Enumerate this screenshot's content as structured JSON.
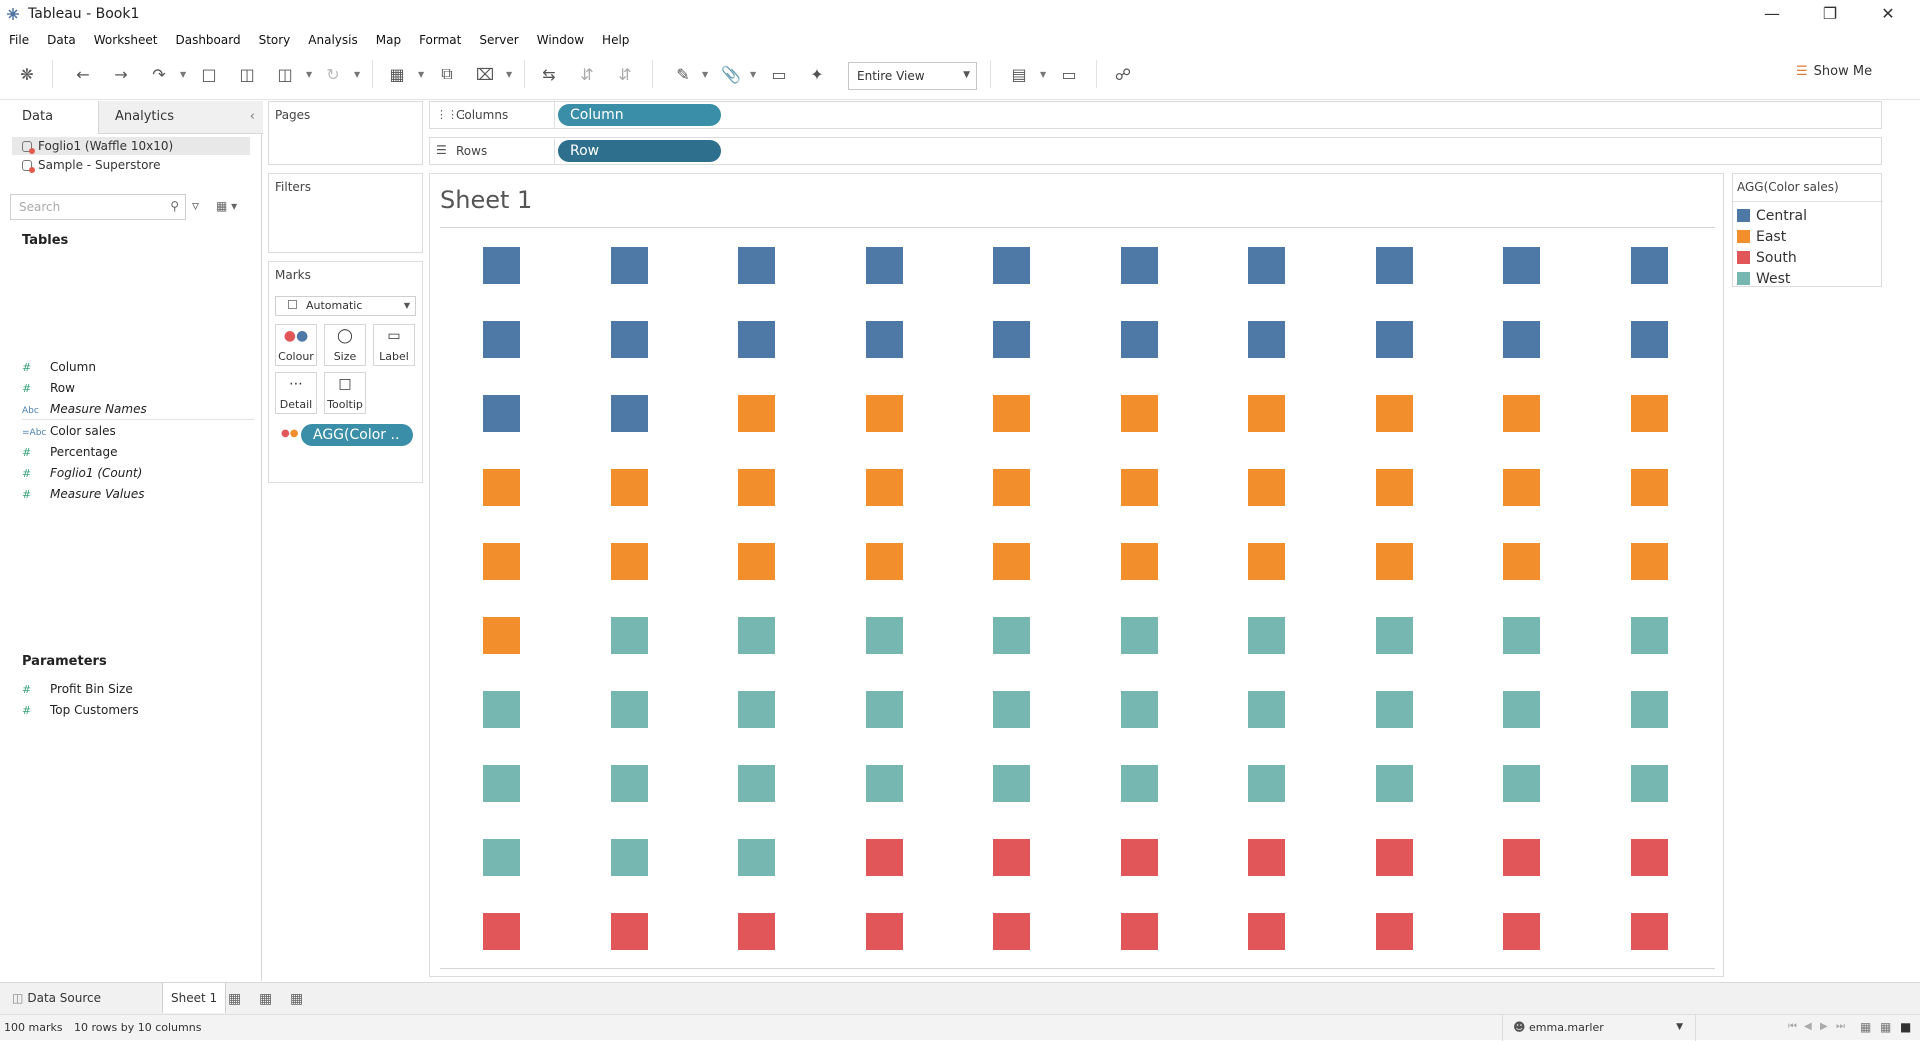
{
  "window": {
    "title": "Tableau - Book1"
  },
  "menu": [
    "File",
    "Data",
    "Worksheet",
    "Dashboard",
    "Story",
    "Analysis",
    "Map",
    "Format",
    "Server",
    "Window",
    "Help"
  ],
  "toolbar": {
    "view_mode": "Entire View",
    "show_me": "Show Me"
  },
  "left_pane": {
    "tabs": [
      "Data",
      "Analytics"
    ],
    "sources": [
      {
        "label": "Foglio1 (Waffle 10x10)",
        "selected": true
      },
      {
        "label": "Sample - Superstore",
        "selected": false
      }
    ],
    "search_placeholder": "Search",
    "tables_header": "Tables",
    "fields": [
      {
        "type": "#",
        "label": "Column",
        "italic": false
      },
      {
        "type": "#",
        "label": "Row",
        "italic": false
      },
      {
        "type": "Abc",
        "label": "Measure Names",
        "italic": true
      },
      {
        "type": "=Abc",
        "label": "Color sales",
        "italic": false
      },
      {
        "type": "#",
        "label": "Percentage",
        "italic": false
      },
      {
        "type": "#",
        "label": "Foglio1 (Count)",
        "italic": true
      },
      {
        "type": "#",
        "label": "Measure Values",
        "italic": true
      }
    ],
    "parameters_header": "Parameters",
    "parameters": [
      {
        "type": "#",
        "label": "Profit Bin Size"
      },
      {
        "type": "#",
        "label": "Top Customers"
      }
    ]
  },
  "pages": {
    "title": "Pages"
  },
  "filters": {
    "title": "Filters"
  },
  "marks": {
    "title": "Marks",
    "type": "Automatic",
    "buttons": [
      "Colour",
      "Size",
      "Label",
      "Detail",
      "Tooltip"
    ],
    "color_pill": "AGG(Color .."
  },
  "shelves": {
    "columns_label": "Columns",
    "columns_pill": "Column",
    "rows_label": "Rows",
    "rows_pill": "Row"
  },
  "sheet": {
    "title": "Sheet 1"
  },
  "legend": {
    "title": "AGG(Color sales)",
    "items": [
      {
        "label": "Central",
        "color": "#4e79a7"
      },
      {
        "label": "East",
        "color": "#f28e2b"
      },
      {
        "label": "South",
        "color": "#e15759"
      },
      {
        "label": "West",
        "color": "#76b7b2"
      }
    ]
  },
  "chart_data": {
    "type": "heatmap",
    "rows": 10,
    "columns": 10,
    "values": [
      [
        "Central",
        "Central",
        "Central",
        "Central",
        "Central",
        "Central",
        "Central",
        "Central",
        "Central",
        "Central"
      ],
      [
        "Central",
        "Central",
        "Central",
        "Central",
        "Central",
        "Central",
        "Central",
        "Central",
        "Central",
        "Central"
      ],
      [
        "Central",
        "Central",
        "East",
        "East",
        "East",
        "East",
        "East",
        "East",
        "East",
        "East"
      ],
      [
        "East",
        "East",
        "East",
        "East",
        "East",
        "East",
        "East",
        "East",
        "East",
        "East"
      ],
      [
        "East",
        "East",
        "East",
        "East",
        "East",
        "East",
        "East",
        "East",
        "East",
        "East"
      ],
      [
        "East",
        "West",
        "West",
        "West",
        "West",
        "West",
        "West",
        "West",
        "West",
        "West"
      ],
      [
        "West",
        "West",
        "West",
        "West",
        "West",
        "West",
        "West",
        "West",
        "West",
        "West"
      ],
      [
        "West",
        "West",
        "West",
        "West",
        "West",
        "West",
        "West",
        "West",
        "West",
        "West"
      ],
      [
        "West",
        "West",
        "West",
        "South",
        "South",
        "South",
        "South",
        "South",
        "South",
        "South"
      ],
      [
        "South",
        "South",
        "South",
        "South",
        "South",
        "South",
        "South",
        "South",
        "South",
        "South"
      ]
    ],
    "colors": {
      "Central": "#4e79a7",
      "East": "#f28e2b",
      "South": "#e15759",
      "West": "#76b7b2"
    }
  },
  "tabs_bar": {
    "data_source": "Data Source",
    "sheet": "Sheet 1"
  },
  "status": {
    "marks": "100 marks",
    "dims": "10 rows by 10 columns",
    "user": "emma.marler"
  }
}
